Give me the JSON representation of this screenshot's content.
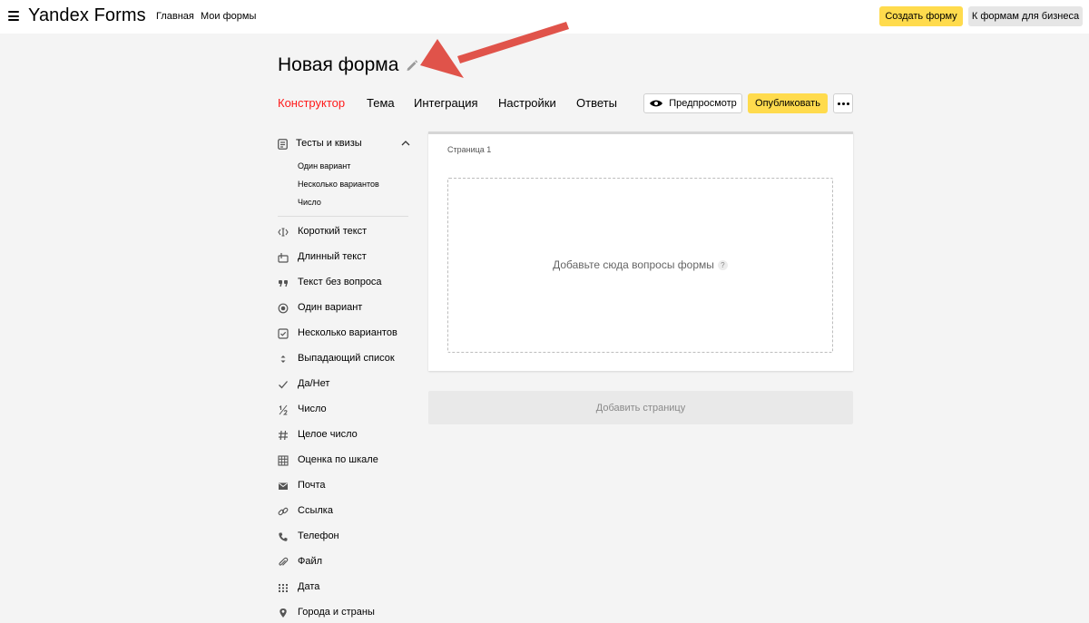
{
  "header": {
    "logo": "Yandex Forms",
    "nav": [
      "Главная",
      "Мои формы"
    ],
    "create_button": "Создать форму",
    "business_button": "К формам для бизнеса"
  },
  "form": {
    "title": "Новая форма"
  },
  "tabs": [
    "Конструктор",
    "Тема",
    "Интеграция",
    "Настройки",
    "Ответы"
  ],
  "active_tab": "Конструктор",
  "toolbar": {
    "preview_label": "Предпросмотр",
    "publish_label": "Опубликовать"
  },
  "sidebar": {
    "section_title": "Тесты и квизы",
    "section_items": [
      "Один вариант",
      "Несколько вариантов",
      "Число"
    ],
    "items": [
      {
        "label": "Короткий текст",
        "icon": "short-text-icon"
      },
      {
        "label": "Длинный текст",
        "icon": "long-text-icon"
      },
      {
        "label": "Текст без вопроса",
        "icon": "quote-icon"
      },
      {
        "label": "Один вариант",
        "icon": "radio-icon"
      },
      {
        "label": "Несколько вариантов",
        "icon": "checkbox-icon"
      },
      {
        "label": "Выпадающий список",
        "icon": "dropdown-icon"
      },
      {
        "label": "Да/Нет",
        "icon": "check-icon"
      },
      {
        "label": "Число",
        "icon": "fraction-icon"
      },
      {
        "label": "Целое число",
        "icon": "hash-icon"
      },
      {
        "label": "Оценка по шкале",
        "icon": "grid-icon"
      },
      {
        "label": "Почта",
        "icon": "mail-icon"
      },
      {
        "label": "Ссылка",
        "icon": "link-icon"
      },
      {
        "label": "Телефон",
        "icon": "phone-icon"
      },
      {
        "label": "Файл",
        "icon": "paperclip-icon"
      },
      {
        "label": "Дата",
        "icon": "calendar-icon"
      },
      {
        "label": "Города и страны",
        "icon": "location-icon"
      }
    ]
  },
  "page": {
    "label": "Страница 1",
    "dropzone_text": "Добавьте сюда вопросы формы",
    "help_glyph": "?",
    "add_page_label": "Добавить страницу"
  },
  "colors": {
    "accent_yellow": "#ffdb4d",
    "active_tab": "#ff1a1a",
    "annotation_arrow": "#e0534a"
  }
}
